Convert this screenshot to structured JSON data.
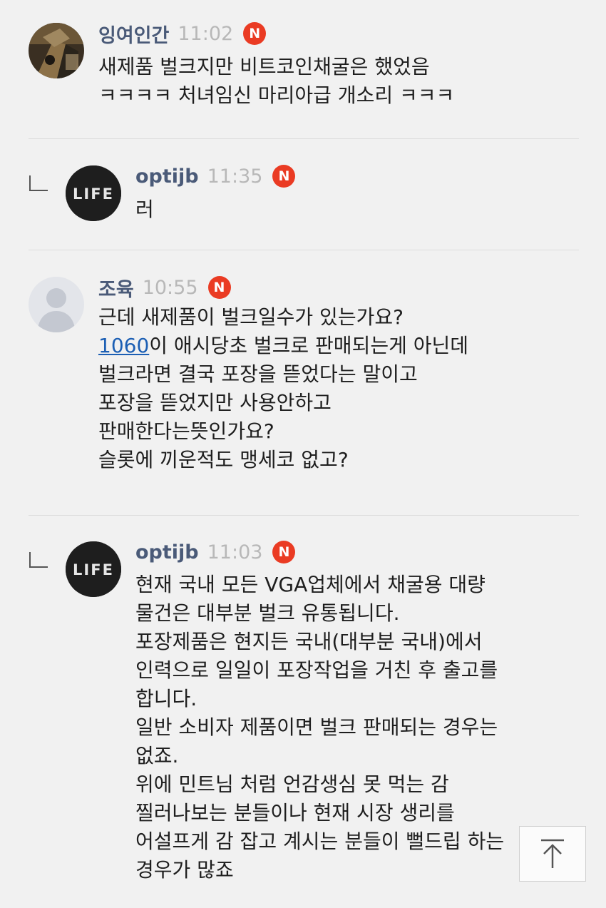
{
  "comments": [
    {
      "username": "잉여인간",
      "time": "11:02",
      "badge": "N",
      "avatar": "photo-avatar",
      "lines": [
        "새제품 벌크지만 비트코인채굴은 했었음",
        "ㅋㅋㅋㅋ 처녀임신 마리아급 개소리 ㅋㅋㅋ"
      ]
    },
    {
      "username": "optijb",
      "time": "11:35",
      "badge": "N",
      "avatar": "LIFE",
      "reply": true,
      "lines": [
        "러"
      ]
    },
    {
      "username": "조육",
      "time": "10:55",
      "badge": "N",
      "avatar": "default-user-avatar",
      "link_text": "1060",
      "line2_rest": "이 애시당초 벌크로 판매되는게 아닌데",
      "lines": [
        "근데 새제품이 벌크일수가 있는가요?",
        "벌크라면 결국 포장을 뜯었다는 말이고",
        "포장을 뜯었지만 사용안하고",
        "판매한다는뜻인가요?",
        "슬롯에 끼운적도 맹세코 없고?"
      ]
    },
    {
      "username": "optijb",
      "time": "11:03",
      "badge": "N",
      "avatar": "LIFE",
      "reply": true,
      "lines": [
        "현재 국내 모든 VGA업체에서 채굴용 대량",
        "물건은 대부분 벌크 유통됩니다.",
        "포장제품은 현지든 국내(대부분 국내)에서",
        "인력으로 일일이 포장작업을 거친 후 출고를",
        "합니다.",
        "일반 소비자 제품이면 벌크 판매되는 경우는",
        "없죠.",
        "위에 민트님 처럼 언감생심 못 먹는 감",
        "찔러나보는 분들이나 현재 시장 생리를",
        "어설프게 감 잡고 계시는 분들이 뻘드립 하는",
        "경우가 많죠"
      ]
    }
  ],
  "colors": {
    "background": "#f1f1f1",
    "username": "#4a5a78",
    "time": "#b8b8b8",
    "badge": "#ea3b23",
    "link": "#1c5fb4"
  },
  "icons": {
    "reply": "reply-arrow-icon",
    "scroll_top": "arrow-up-to-top-icon"
  }
}
